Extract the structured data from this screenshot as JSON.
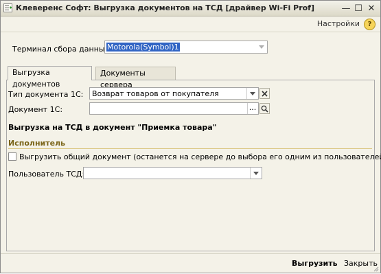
{
  "window": {
    "title": "Клеверенс Софт: Выгрузка документов на ТСД [драйвер Wi-Fi Prof]",
    "minimize_glyph": "—",
    "maximize_glyph": "☐",
    "close_glyph": "✕"
  },
  "toolbar": {
    "settings_label": "Настройки",
    "help_glyph": "?"
  },
  "terminal": {
    "label": "Терминал сбора данных:",
    "value": "Motorola(Symbol)1"
  },
  "tabs": [
    {
      "label": "Выгрузка документов",
      "active": true
    },
    {
      "label": "Документы сервера",
      "active": false
    }
  ],
  "form": {
    "doc_type_label": "Тип документа 1С:",
    "doc_type_value": "Возврат товаров от покупателя",
    "clear_glyph": "✕",
    "document_label": "Документ 1С:",
    "document_value": "",
    "ellipsis_glyph": "...",
    "export_target_text": "Выгрузка на ТСД в документ \"Приемка товара\"",
    "executor_section": "Исполнитель",
    "shared_doc_checkbox_label": "Выгрузить общий документ (останется на сервере до выбора его одним из пользователей)",
    "shared_doc_checked": false,
    "user_label": "Пользователь ТСД:",
    "user_value": ""
  },
  "footer": {
    "export_button": "Выгрузить",
    "close_button": "Закрыть"
  },
  "colors": {
    "window_bg": "#f4f2e8",
    "selection": "#3064c4",
    "section_title": "#7a6418",
    "clear_icon": "#cc2222"
  },
  "icons": {
    "app": "app-icon",
    "dropdown": "chevron-down-icon",
    "clear": "clear-icon",
    "search": "search-icon",
    "help": "help-icon"
  }
}
